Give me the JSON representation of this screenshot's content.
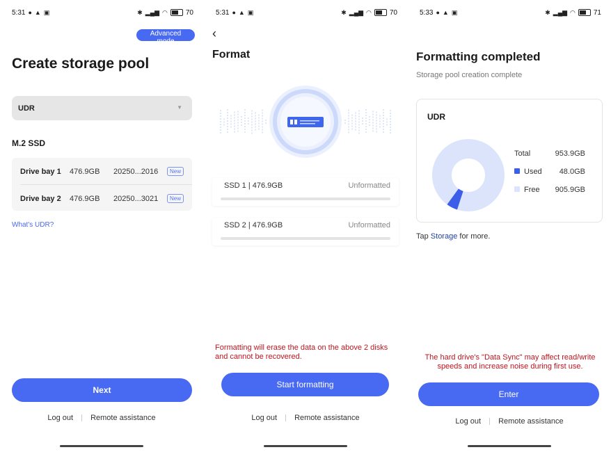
{
  "colors": {
    "accent": "#4869f2",
    "warning": "#c0141e",
    "used": "#3c5ee8",
    "free": "#dbe4fb"
  },
  "screen1": {
    "status": {
      "time": "5:31",
      "battery": "70"
    },
    "advanced_mode": "Advanced mode",
    "title": "Create storage pool",
    "dropdown_value": "UDR",
    "section": "M.2 SSD",
    "drives": [
      {
        "name": "Drive bay 1",
        "size": "476.9GB",
        "serial": "20250...2016",
        "badge": "New"
      },
      {
        "name": "Drive bay 2",
        "size": "476.9GB",
        "serial": "20250...3021",
        "badge": "New"
      }
    ],
    "link": "What's UDR?",
    "next": "Next",
    "logout": "Log out",
    "remote": "Remote assistance"
  },
  "screen2": {
    "status": {
      "time": "5:31",
      "battery": "70"
    },
    "title": "Format",
    "ssds": [
      {
        "label": "SSD 1 | 476.9GB",
        "status": "Unformatted",
        "progress": 0
      },
      {
        "label": "SSD 2 | 476.9GB",
        "status": "Unformatted",
        "progress": 0
      }
    ],
    "warning": "Formatting will erase the data on the above 2 disks and cannot be recovered.",
    "start": "Start formatting",
    "logout": "Log out",
    "remote": "Remote assistance"
  },
  "screen3": {
    "status": {
      "time": "5:33",
      "battery": "71"
    },
    "title": "Formatting completed",
    "subtitle": "Storage pool creation complete",
    "pool_name": "UDR",
    "total_label": "Total",
    "total_value": "953.9GB",
    "used_label": "Used",
    "used_value": "48.0GB",
    "free_label": "Free",
    "free_value": "905.9GB",
    "used_fraction": 0.05,
    "hint_pre": "Tap ",
    "hint_link": "Storage",
    "hint_post": " for more.",
    "warning": "The hard drive's \"Data Sync\" may affect read/write speeds and increase noise during first use.",
    "enter": "Enter",
    "logout": "Log out",
    "remote": "Remote assistance"
  }
}
